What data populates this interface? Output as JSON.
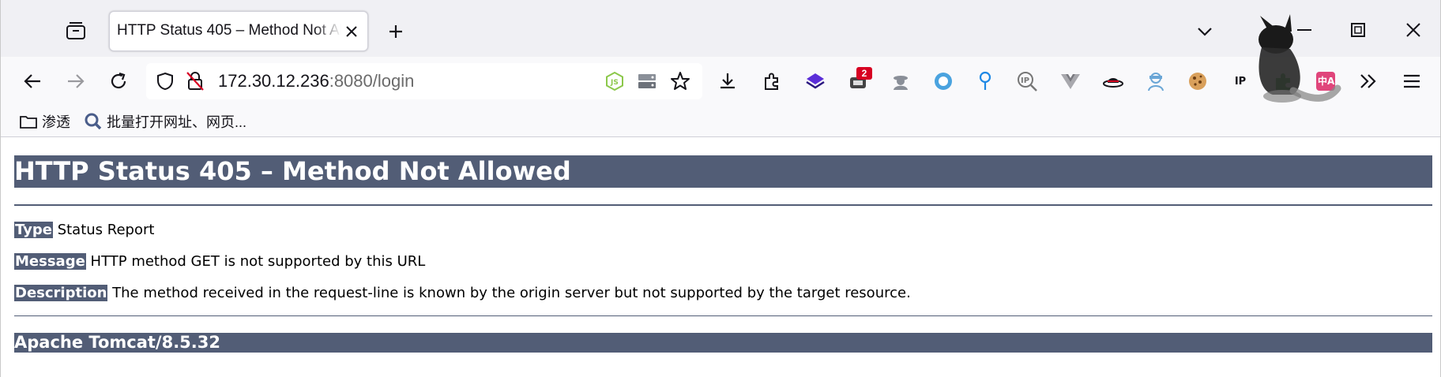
{
  "tab": {
    "title": "HTTP Status 405 – Method Not Allowed"
  },
  "urlbar": {
    "host": "172.30.12.236",
    "rest": ":8080/login"
  },
  "toolbar": {
    "notification_badge": "2",
    "ip_icon_label": "IP",
    "translate_icon_label": "中A"
  },
  "bookmarks": [
    {
      "label": "渗透",
      "icon": "folder-icon"
    },
    {
      "label": "批量打开网址、网页...",
      "icon": "search-icon"
    }
  ],
  "page": {
    "heading": "HTTP Status 405 – Method Not Allowed",
    "type_label": "Type",
    "type_value": "Status Report",
    "message_label": "Message",
    "message_value": "HTTP method GET is not supported by this URL",
    "description_label": "Description",
    "description_value": "The method received in the request-line is known by the origin server but not supported by the target resource.",
    "footer": "Apache Tomcat/8.5.32"
  },
  "colors": {
    "tomcat_bar": "#525d76",
    "tab_strip": "#f0f0f4",
    "toolbar": "#f9f9fb",
    "badge": "#d70022"
  }
}
